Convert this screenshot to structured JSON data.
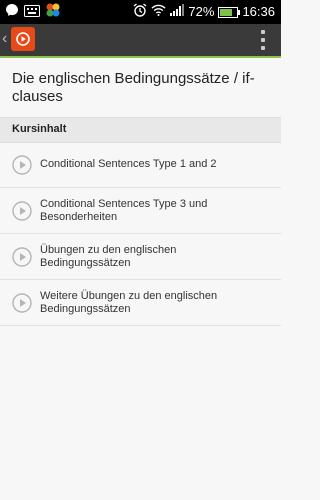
{
  "status_bar": {
    "icons": [
      "messenger-icon",
      "keyboard-icon",
      "app-notification-icon",
      "alarm-icon",
      "wifi-icon",
      "signal-icon",
      "battery-icon"
    ],
    "battery": "72%",
    "battery_level": 0.72,
    "time": "16:36"
  },
  "app_bar": {
    "icons": [
      "back-chevron-icon",
      "app-logo-icon",
      "overflow-menu-icon"
    ],
    "accent": "#8bc34a",
    "logo_color": "#e64a19"
  },
  "page": {
    "title": "Die englischen Bedingungssätze / if-clauses"
  },
  "section": {
    "header": "Kursinhalt"
  },
  "lessons": [
    {
      "label": "Conditional Sentences Type 1 and 2",
      "icon": "play-icon"
    },
    {
      "label": "Conditional Sentences Type 3 und Besonderheiten",
      "icon": "play-icon"
    },
    {
      "label": "Übungen zu den englischen Bedingungssätzen",
      "icon": "play-icon"
    },
    {
      "label": "Weitere Übungen zu den englischen Bedingungssätzen",
      "icon": "play-icon"
    }
  ]
}
